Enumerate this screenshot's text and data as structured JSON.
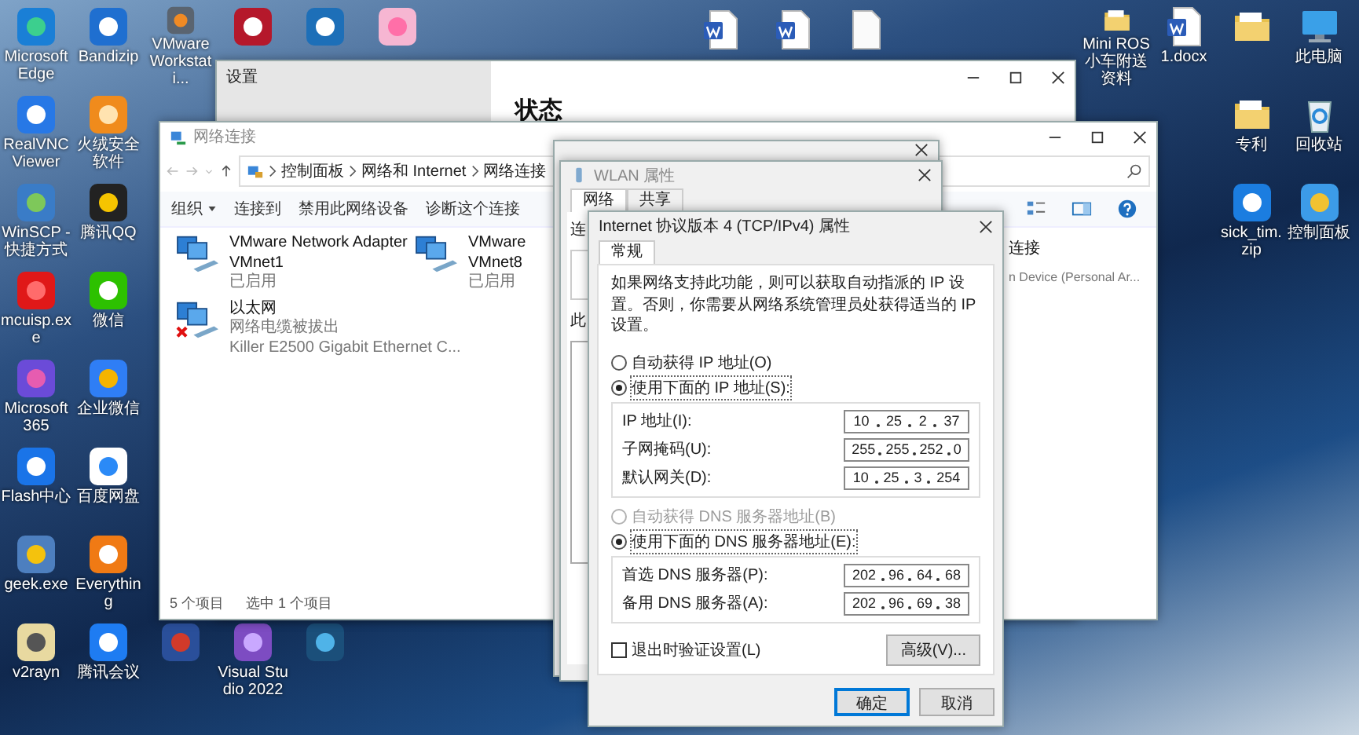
{
  "desktop": {
    "left_rows": [
      [
        {
          "kind": "edge",
          "label": "Microsoft Edge"
        },
        {
          "kind": "bandizip",
          "label": "Bandizip"
        },
        {
          "kind": "vmware",
          "label": "VMware Workstati..."
        },
        {
          "kind": "autocad"
        },
        {
          "kind": "et"
        },
        {
          "kind": "heart"
        }
      ],
      [
        {
          "kind": "vnc",
          "label": "RealVNC Viewer"
        },
        {
          "kind": "huorong",
          "label": "火绒安全软件"
        }
      ],
      [
        {
          "kind": "winscp",
          "label": "WinSCP - 快捷方式"
        },
        {
          "kind": "qq",
          "label": "腾讯QQ"
        }
      ],
      [
        {
          "kind": "mcuisp",
          "label": "mcuisp.exe"
        },
        {
          "kind": "wechat",
          "label": "微信"
        }
      ],
      [
        {
          "kind": "m365",
          "label": "Microsoft 365"
        },
        {
          "kind": "wecom",
          "label": "企业微信"
        }
      ],
      [
        {
          "kind": "flash",
          "label": "Flash中心"
        },
        {
          "kind": "baidu",
          "label": "百度网盘"
        }
      ],
      [
        {
          "kind": "geek",
          "label": "geek.exe"
        },
        {
          "kind": "everything",
          "label": "Everything"
        }
      ],
      [
        {
          "kind": "v2rayn",
          "label": "v2rayn"
        },
        {
          "kind": "meeting",
          "label": "腾讯会议"
        },
        {
          "kind": "solid"
        },
        {
          "kind": "vs",
          "label": "Visual Studio 2022"
        },
        {
          "kind": "steam"
        }
      ]
    ],
    "top_files": [
      {
        "kind": "word"
      },
      {
        "kind": "word"
      },
      {
        "kind": "file"
      }
    ],
    "right_rows": [
      [
        {
          "kind": "folder",
          "label": "Mini ROS小车附送资料"
        },
        {
          "kind": "word",
          "label": "1.docx"
        },
        {
          "kind": "folder"
        },
        {
          "kind": "computer",
          "label": "此电脑"
        }
      ],
      [
        {
          "kind": "folder",
          "label": "专利"
        },
        {
          "kind": "recycle",
          "label": "回收站"
        }
      ],
      [
        {
          "kind": "zip",
          "label": "sick_tim.zip"
        },
        {
          "kind": "control",
          "label": "控制面板"
        }
      ]
    ]
  },
  "settings_window": {
    "title": "设置",
    "heading": "状态"
  },
  "network_window": {
    "title": "网络连接",
    "breadcrumb": [
      "控制面板",
      "网络和 Internet",
      "网络连接"
    ],
    "organize_menu": "组织",
    "commands": [
      "连接到",
      "禁用此网络设备",
      "诊断这个连接"
    ],
    "adapters": [
      {
        "name_lines": [
          "VMware Network Adapter",
          "VMnet1"
        ],
        "status": "已启用",
        "disconnected": false
      },
      {
        "name_lines": [
          "VMware",
          "VMnet8"
        ],
        "status": "已启用",
        "disconnected": false
      },
      {
        "name_lines": [
          "以太网"
        ],
        "status": "网络电缆被拔出",
        "device": "Killer E2500 Gigabit Ethernet C...",
        "disconnected": true
      }
    ],
    "partial_adapter": {
      "name": "连接",
      "device": "n Device (Personal Ar..."
    },
    "status_bar": [
      "5 个项目",
      "选中 1 个项目"
    ]
  },
  "wlan_properties": {
    "title": "WLAN 属性",
    "tabs": [
      {
        "label": "网络",
        "selected": true
      },
      {
        "label": "共享",
        "selected": false
      }
    ],
    "visible_labels": [
      "连",
      "此"
    ]
  },
  "ipv4_dialog": {
    "title": "Internet 协议版本 4 (TCP/IPv4) 属性",
    "tabs": [
      {
        "label": "常规",
        "selected": true
      }
    ],
    "description": "如果网络支持此功能，则可以获取自动指派的 IP 设置。否则，你需要从网络系统管理员处获得适当的 IP 设置。",
    "ip_options": [
      {
        "label": "自动获得 IP 地址(O)",
        "selected": false,
        "disabled": false
      },
      {
        "label": "使用下面的 IP 地址(S):",
        "selected": true,
        "disabled": false
      }
    ],
    "ip_fields": [
      {
        "label": "IP 地址(I):",
        "octets": [
          "10",
          "25",
          "2",
          "37"
        ]
      },
      {
        "label": "子网掩码(U):",
        "octets": [
          "255",
          "255",
          "252",
          "0"
        ]
      },
      {
        "label": "默认网关(D):",
        "octets": [
          "10",
          "25",
          "3",
          "254"
        ]
      }
    ],
    "dns_options": [
      {
        "label": "自动获得 DNS 服务器地址(B)",
        "selected": false,
        "disabled": true
      },
      {
        "label": "使用下面的 DNS 服务器地址(E):",
        "selected": true,
        "disabled": false
      }
    ],
    "dns_fields": [
      {
        "label": "首选 DNS 服务器(P):",
        "octets": [
          "202",
          "96",
          "64",
          "68"
        ]
      },
      {
        "label": "备用 DNS 服务器(A):",
        "octets": [
          "202",
          "96",
          "69",
          "38"
        ]
      }
    ],
    "validate": {
      "label": "退出时验证设置(L)",
      "checked": false
    },
    "advanced_button": "高级(V)...",
    "buttons": [
      {
        "label": "确定",
        "default": true
      },
      {
        "label": "取消",
        "default": false
      }
    ]
  }
}
